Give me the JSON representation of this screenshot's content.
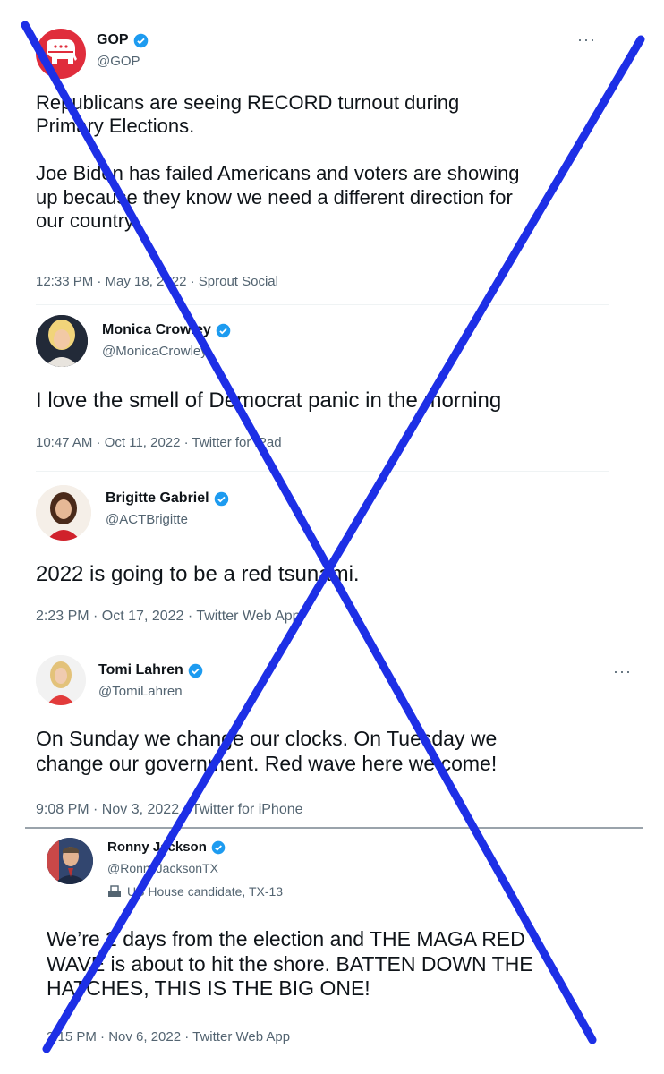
{
  "colors": {
    "cross": "#1d2fe6",
    "verified": "#1d9bf0",
    "gop_red": "#e02d3c"
  },
  "tweets": [
    {
      "name": "GOP",
      "handle": "@GOP",
      "text": "Republicans are seeing RECORD turnout during\nPrimary Elections.\n\nJoe Biden has failed Americans and voters are showing\nup because they know we need a different direction for\nour country.",
      "meta": "12:33 PM · May 18, 2022 · Sprout Social",
      "avatar_icon": "elephant-logo-icon"
    },
    {
      "name": "Monica Crowley",
      "handle": "@MonicaCrowley",
      "text": "I love the smell of Democrat panic in the morning",
      "meta": "10:47 AM · Oct 11, 2022 · Twitter for iPad",
      "avatar_icon": "user-photo"
    },
    {
      "name": "Brigitte Gabriel",
      "handle": "@ACTBrigitte",
      "text": "2022 is going to be a red tsunami.",
      "meta": "2:23 PM · Oct 17, 2022 · Twitter Web App",
      "avatar_icon": "user-photo"
    },
    {
      "name": "Tomi Lahren",
      "handle": "@TomiLahren",
      "text": "On Sunday we change our clocks. On Tuesday we\nchange our government. Red wave here we come!",
      "meta": "9:08 PM · Nov 3, 2022 · Twitter for iPhone",
      "avatar_icon": "user-photo"
    },
    {
      "name": "Ronny Jackson",
      "handle": "@RonnyJacksonTX",
      "label": "US House candidate, TX-13",
      "text": "We’re 2 days from the election and THE MAGA RED\nWAVE is about to hit the shore. BATTEN DOWN THE\nHATCHES, THIS IS THE BIG ONE!",
      "meta": "2:15 PM · Nov 6, 2022 · Twitter Web App",
      "avatar_icon": "user-photo"
    }
  ],
  "more_label": "···"
}
